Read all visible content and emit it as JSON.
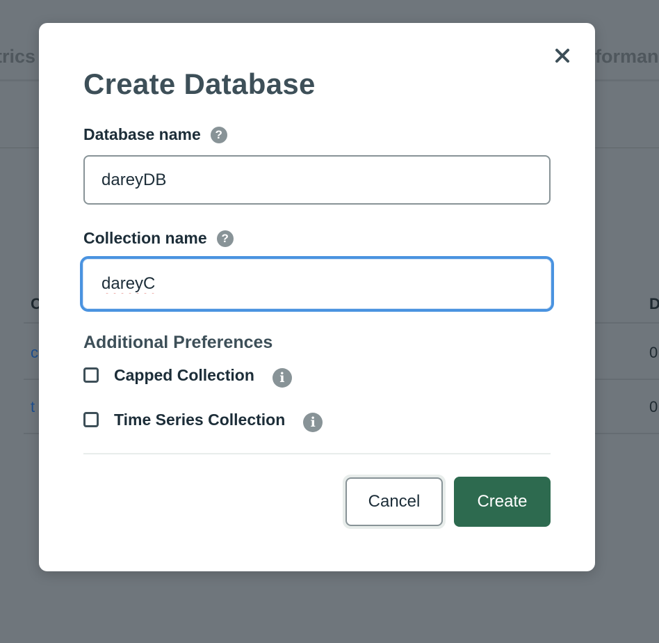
{
  "background": {
    "tab_left": "trics",
    "tab_right": "forman",
    "table_header_first": "C",
    "table_header_last": "D",
    "rows": [
      {
        "first": "c",
        "last": "0"
      },
      {
        "first": "t",
        "last": "0"
      }
    ]
  },
  "modal": {
    "title": "Create Database",
    "close_glyph": "✕",
    "database_name": {
      "label": "Database name",
      "help_glyph": "?",
      "value": "dareyDB"
    },
    "collection_name": {
      "label": "Collection name",
      "help_glyph": "?",
      "value": "dareyC"
    },
    "additional_preferences": {
      "title": "Additional Preferences",
      "options": [
        {
          "label": "Capped Collection",
          "checked": false,
          "info_glyph": "i"
        },
        {
          "label": "Time Series Collection",
          "checked": false,
          "info_glyph": "i"
        }
      ]
    },
    "buttons": {
      "cancel": "Cancel",
      "create": "Create"
    }
  },
  "colors": {
    "overlay": "#6f767c",
    "title": "#3d4f58",
    "focus_ring": "#4a93e0",
    "primary_button": "#2d6a4f",
    "icon_gray": "#889397"
  },
  "icons": {
    "close": "close-icon",
    "help": "question-icon",
    "info": "info-icon"
  }
}
